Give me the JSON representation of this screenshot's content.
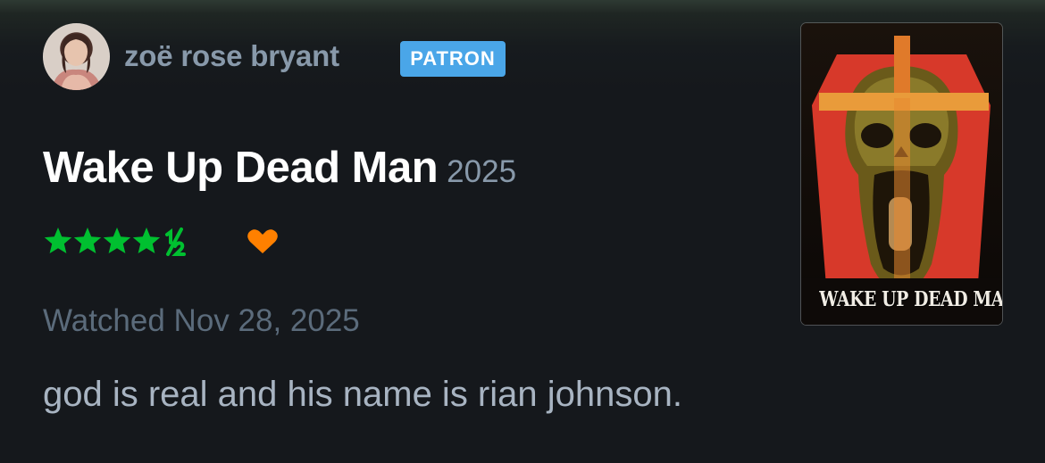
{
  "user": {
    "name": "zoë rose bryant",
    "badge": "PATRON"
  },
  "film": {
    "title": "Wake Up Dead Man",
    "year": "2025",
    "rating": 4.5,
    "rating_text": "★★★★½",
    "liked": true,
    "poster_text": "WAKE UP DEAD MAN"
  },
  "watched": "Watched Nov 28, 2025",
  "review": "god is real and his name is rian johnson.",
  "colors": {
    "background": "#15181c",
    "star": "#00c030",
    "heart": "#ff8000",
    "badge": "#4aa6e8",
    "username": "#8899aa"
  },
  "icons": {
    "rating": "star-icon",
    "like": "heart-icon"
  }
}
